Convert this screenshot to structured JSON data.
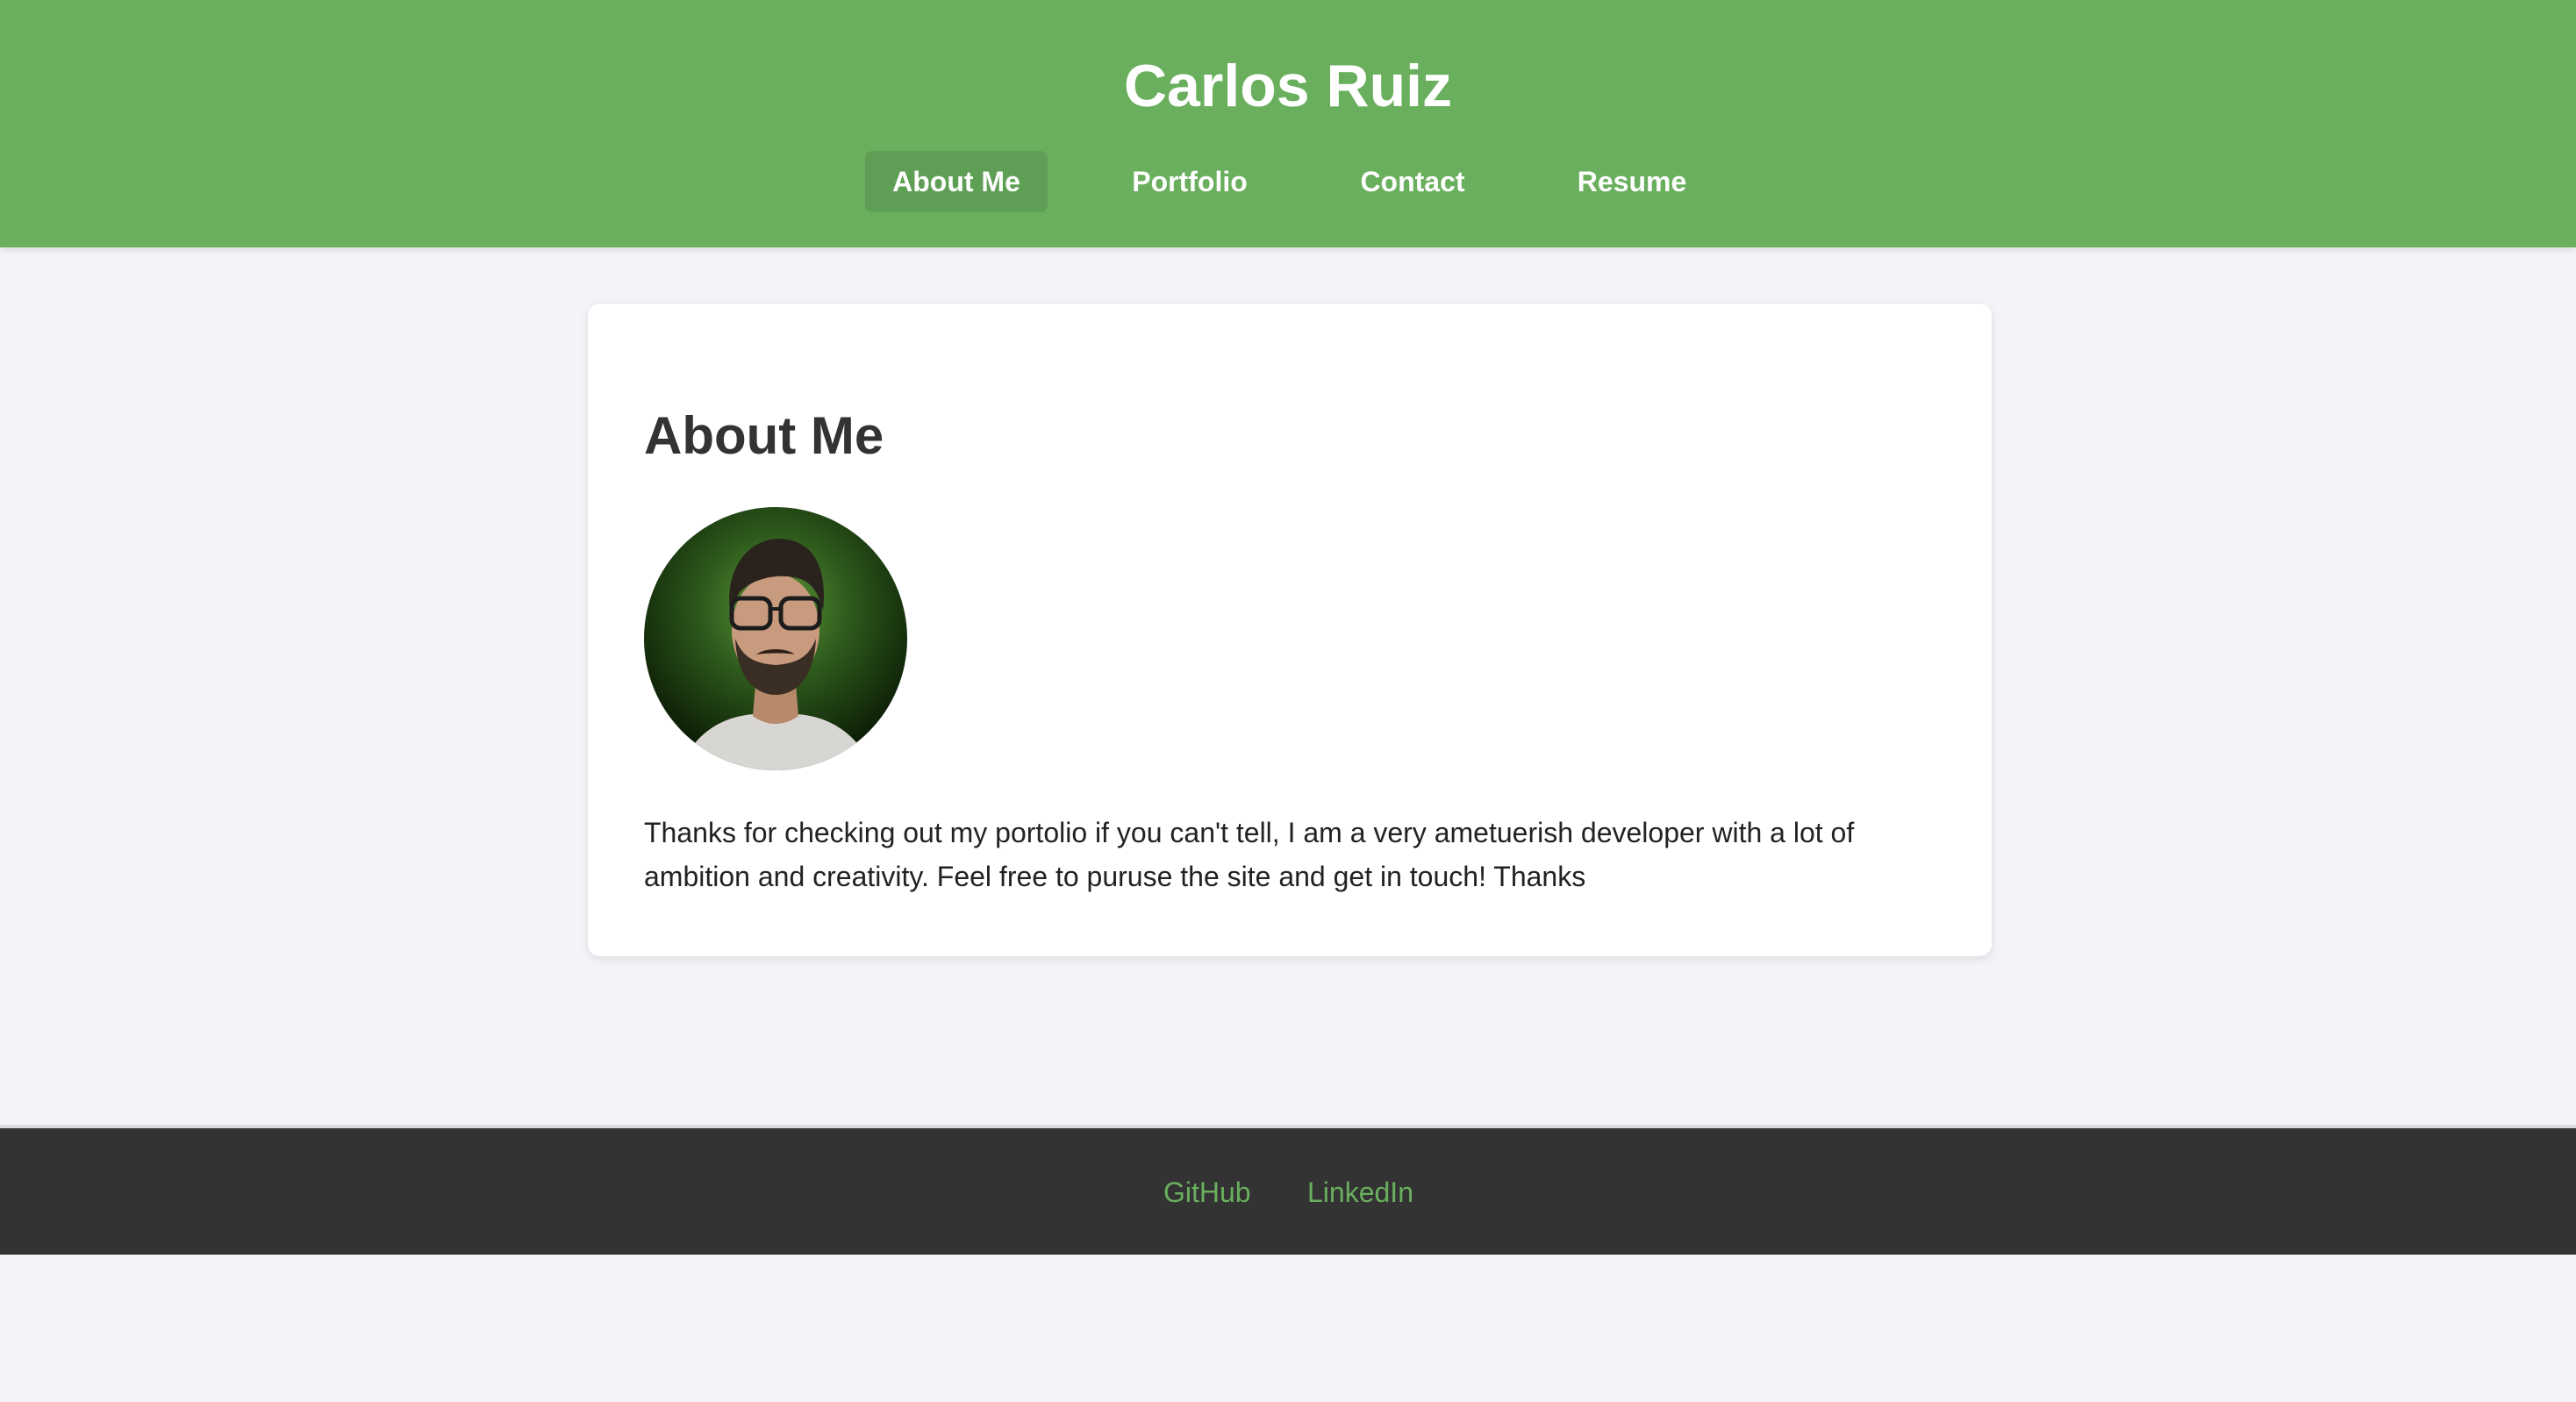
{
  "header": {
    "title": "Carlos Ruiz",
    "nav": [
      {
        "label": "About Me",
        "active": true
      },
      {
        "label": "Portfolio",
        "active": false
      },
      {
        "label": "Contact",
        "active": false
      },
      {
        "label": "Resume",
        "active": false
      }
    ]
  },
  "about": {
    "heading": "About Me",
    "bio": "Thanks for checking out my portolio if you can't tell, I am a very ametuerish developer with a lot of ambition and creativity. Feel free to puruse the site and get in touch! Thanks"
  },
  "footer": {
    "links": [
      "GitHub",
      "LinkedIn"
    ]
  },
  "colors": {
    "header_bg": "#6aaf5e",
    "nav_active_bg": "#5f9f55",
    "page_bg": "#f4f3f8",
    "footer_bg": "#333333",
    "footer_link": "#6aaf5e"
  }
}
